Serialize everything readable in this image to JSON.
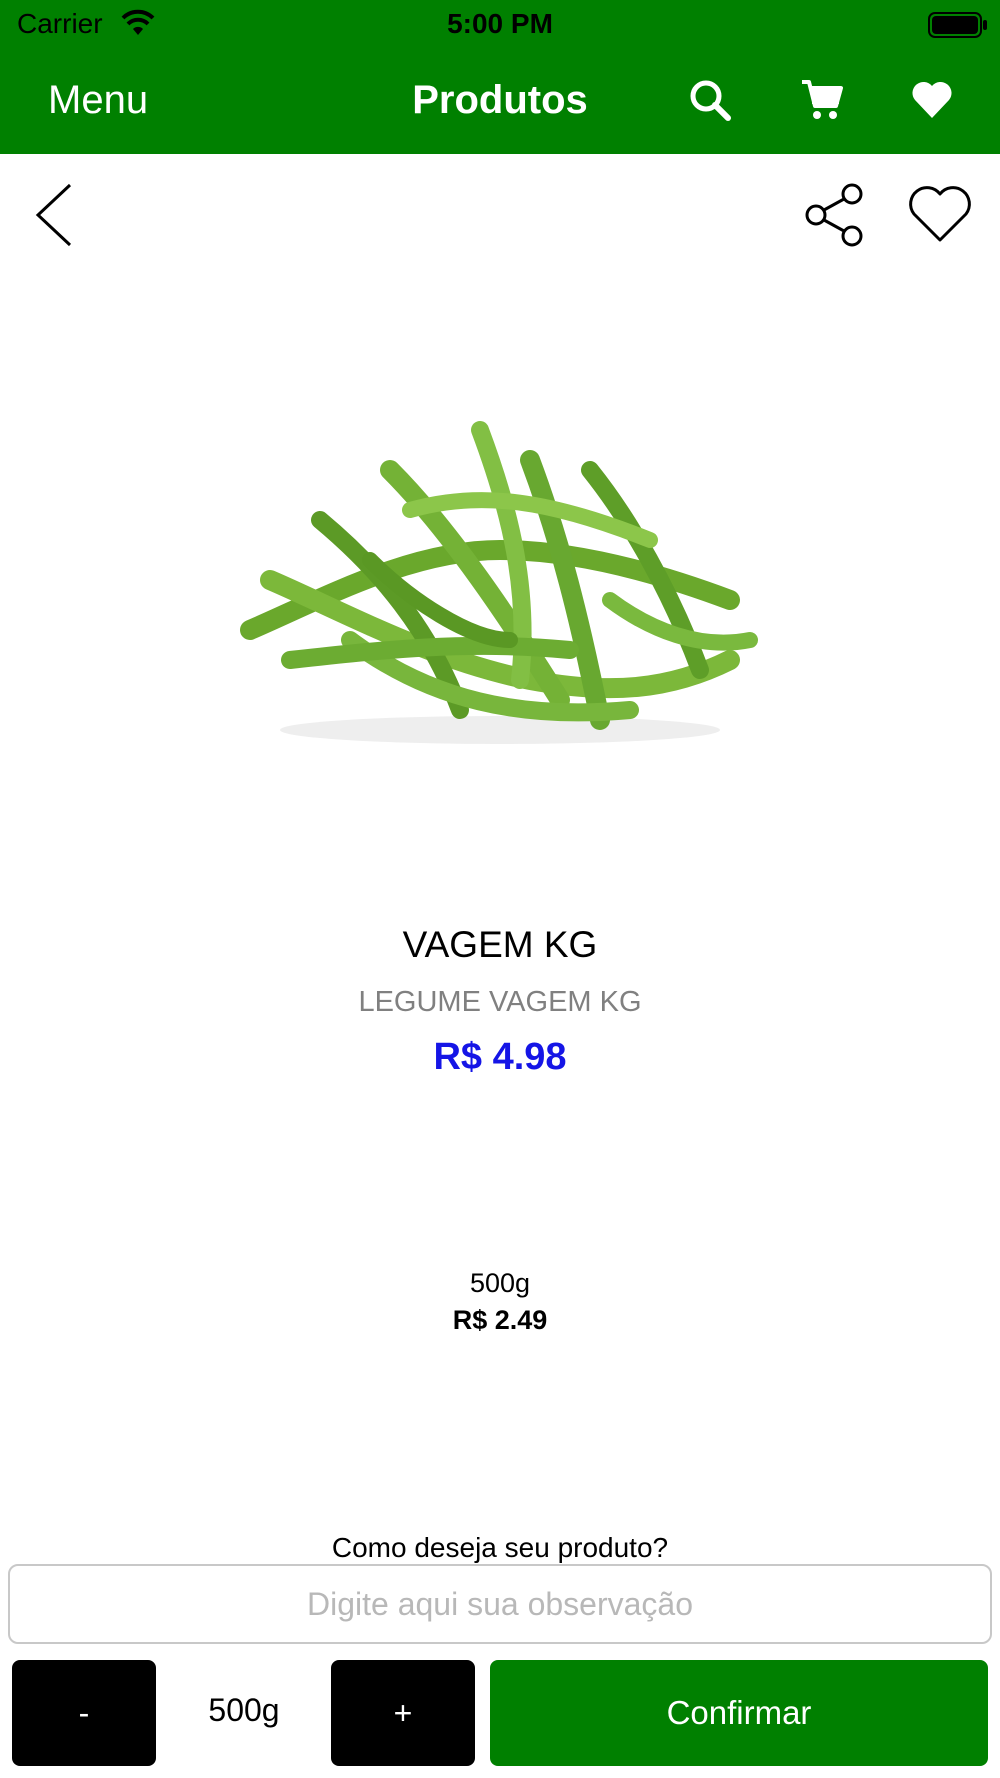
{
  "status_bar": {
    "carrier": "Carrier",
    "time": "5:00 PM"
  },
  "navbar": {
    "menu_label": "Menu",
    "title": "Produtos",
    "icons": [
      "search-icon",
      "cart-icon",
      "heart-icon"
    ],
    "background": "#008000"
  },
  "actions": {
    "icons": [
      "back-chevron-icon",
      "share-icon",
      "favorite-heart-icon"
    ]
  },
  "product": {
    "name": "VAGEM KG",
    "description": "LEGUME VAGEM KG",
    "price": "R$ 4.98",
    "price_color": "#1515e6"
  },
  "unit": {
    "weight": "500g",
    "price": "R$ 2.49"
  },
  "observation": {
    "label": "Como deseja seu produto?",
    "placeholder": "Digite aqui sua observação"
  },
  "quantity": {
    "decrement_label": "-",
    "value": "500g",
    "increment_label": "+"
  },
  "confirm": {
    "label": "Confirmar",
    "color": "#008000"
  }
}
